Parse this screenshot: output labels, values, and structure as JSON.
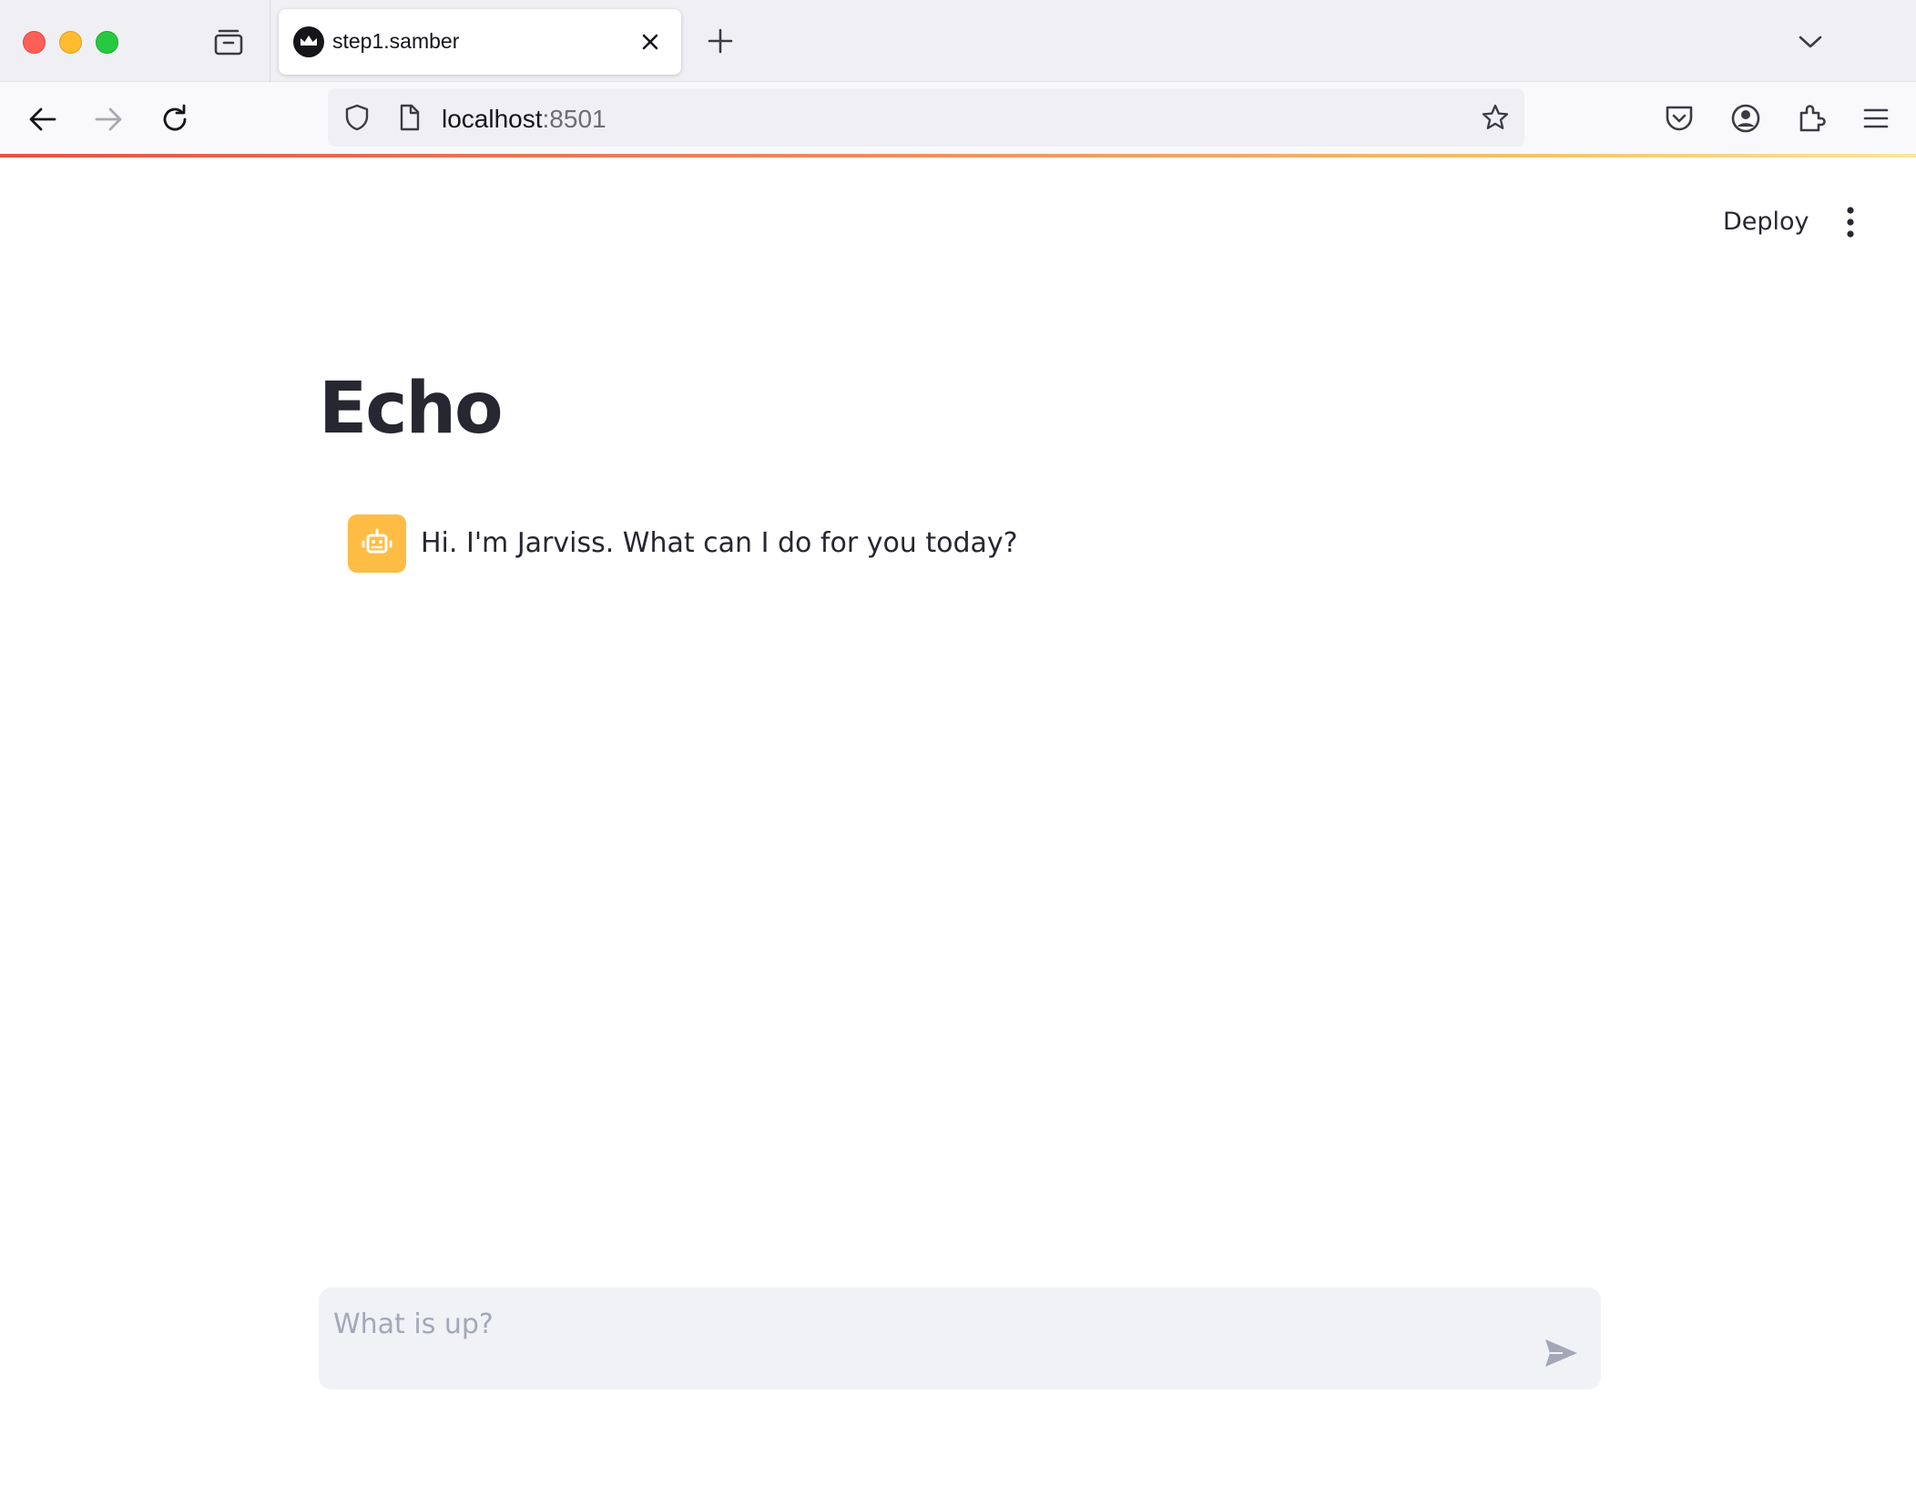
{
  "browser": {
    "tab": {
      "title": "step1.samber"
    },
    "url": {
      "host": "localhost",
      "port": ":8501"
    }
  },
  "app": {
    "header": {
      "deploy_label": "Deploy"
    },
    "title": "Echo",
    "messages": [
      {
        "role": "assistant",
        "avatar_icon": "robot-icon",
        "text": "Hi. I'm Jarviss. What can I do for you today?"
      }
    ],
    "chat_input": {
      "placeholder": "What is up?",
      "value": ""
    }
  },
  "colors": {
    "avatar_bg": "#ffbd45",
    "input_bg": "#f0f2f6",
    "text": "#262730"
  }
}
